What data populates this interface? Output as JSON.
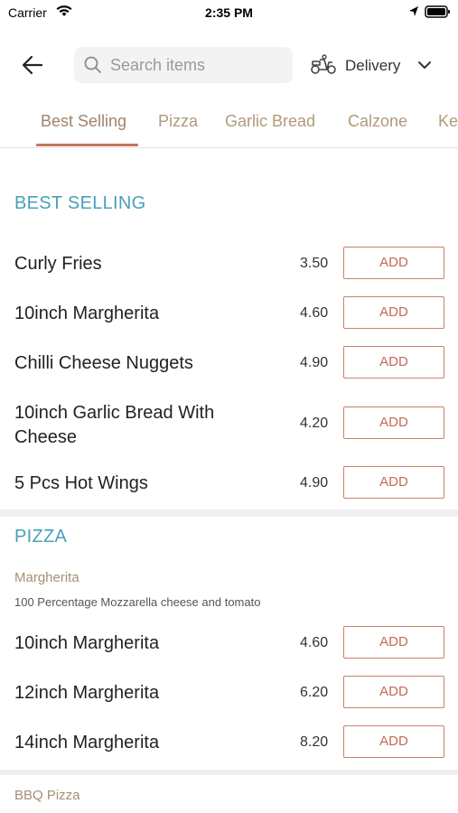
{
  "status_bar": {
    "carrier": "Carrier",
    "time": "2:35 PM"
  },
  "header": {
    "search_placeholder": "Search items",
    "delivery_label": "Delivery"
  },
  "tabs": [
    {
      "label": "Best Selling",
      "active": true
    },
    {
      "label": "Pizza",
      "active": false
    },
    {
      "label": "Garlic Bread",
      "active": false
    },
    {
      "label": "Calzone",
      "active": false
    },
    {
      "label": "Ke",
      "active": false
    }
  ],
  "best_selling": {
    "title": "BEST SELLING",
    "add_label": "ADD",
    "items": [
      {
        "name": "Curly Fries",
        "price": "3.50"
      },
      {
        "name": "10inch Margherita",
        "price": "4.60"
      },
      {
        "name": "Chilli Cheese Nuggets",
        "price": "4.90"
      },
      {
        "name": "10inch Garlic Bread With Cheese",
        "price": "4.20"
      },
      {
        "name": "5 Pcs Hot Wings",
        "price": "4.90"
      }
    ]
  },
  "pizza": {
    "title": "PIZZA",
    "group_name": "Margherita",
    "group_desc": "100 Percentage Mozzarella cheese and tomato",
    "add_label": "ADD",
    "items": [
      {
        "name": "10inch Margherita",
        "price": "4.60"
      },
      {
        "name": "12inch Margherita",
        "price": "6.20"
      },
      {
        "name": "14inch Margherita",
        "price": "8.20"
      }
    ],
    "next_group_name": "BBQ Pizza"
  },
  "colors": {
    "accent": "#c26a55",
    "section_title": "#4aa0b8",
    "tab_text": "#b09a7a"
  }
}
